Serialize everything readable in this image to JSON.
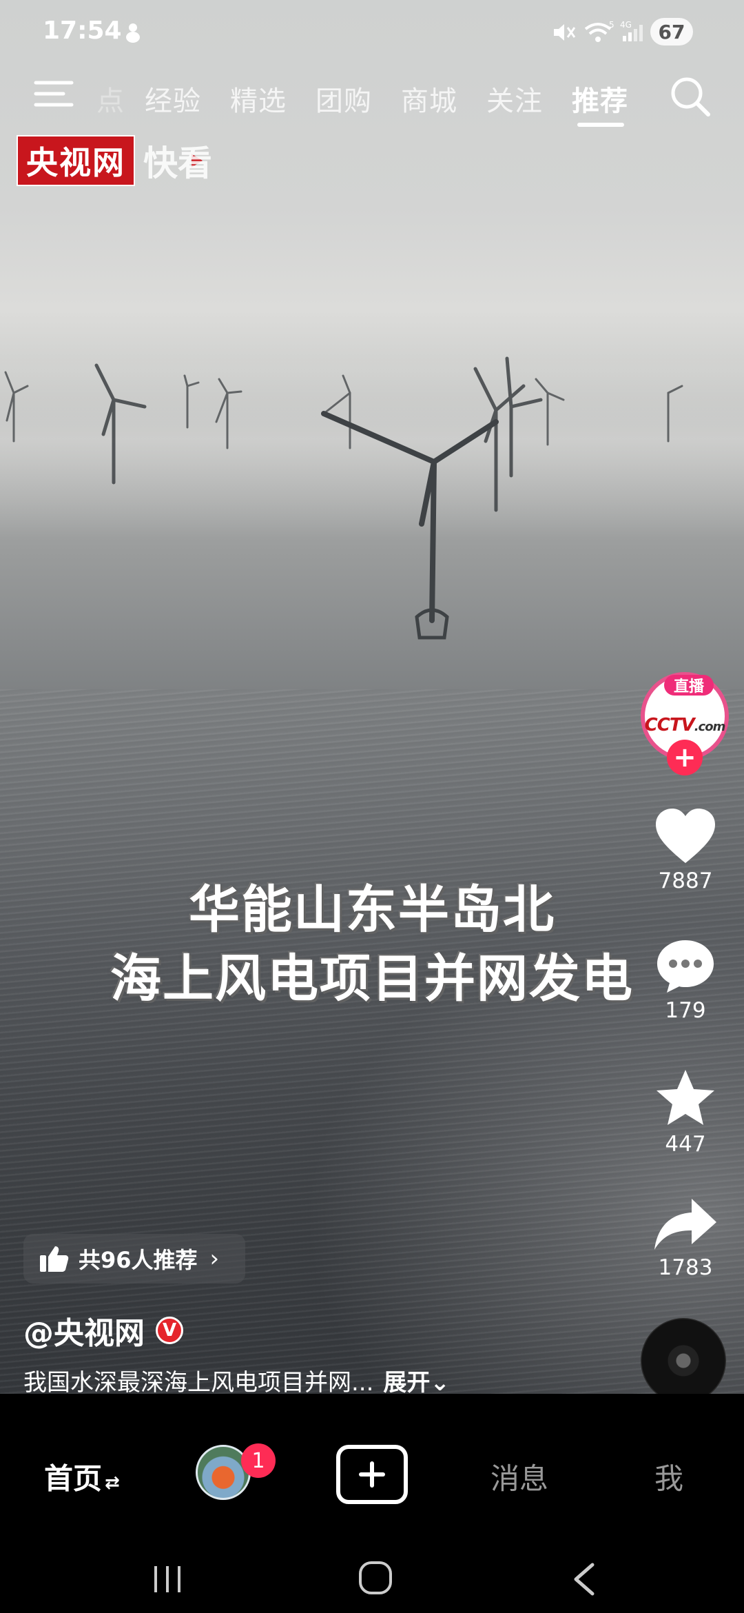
{
  "status_bar": {
    "time": "17:54",
    "signal_label": "4G",
    "wifi_label": "5",
    "battery": "67"
  },
  "top_nav": {
    "tabs": [
      {
        "label": "点",
        "state": "faded"
      },
      {
        "label": "经验",
        "state": "normal"
      },
      {
        "label": "精选",
        "state": "normal"
      },
      {
        "label": "团购",
        "state": "normal"
      },
      {
        "label": "商城",
        "state": "normal"
      },
      {
        "label": "关注",
        "state": "normal"
      },
      {
        "label": "推荐",
        "state": "active"
      }
    ]
  },
  "watermark": {
    "brand": "央视网",
    "product": "快看"
  },
  "caption": {
    "line1": "华能山东半岛北",
    "line2": "海上风电项目并网发电"
  },
  "creator": {
    "live_label": "直播",
    "logo_text": "CCTV",
    "logo_suffix": ".com",
    "follow_symbol": "+"
  },
  "actions": {
    "likes": "7887",
    "comments": "179",
    "favorites": "447",
    "shares": "1783"
  },
  "recommend": {
    "text": "共96人推荐",
    "chevron": "›"
  },
  "author": {
    "name": "@央视网",
    "verified_mark": "V"
  },
  "description": {
    "text": "我国水深最深海上风电项目并网...",
    "expand_label": "展开⌄"
  },
  "bottom_nav": {
    "home": "首页",
    "home_switch": "⇄",
    "friend_badge": "1",
    "messages": "消息",
    "me": "我"
  },
  "colors": {
    "accent": "#fe2c55",
    "cctv_red": "#c8161d",
    "live_pink": "#ef2c78"
  }
}
